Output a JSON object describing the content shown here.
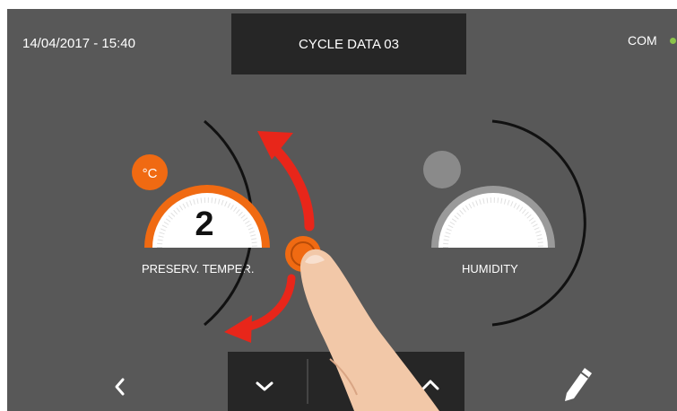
{
  "status": {
    "datetime": "14/04/2017 - 15:40",
    "com_label": "COM",
    "com_color": "#8bc34a"
  },
  "header": {
    "title": "CYCLE DATA 03"
  },
  "dials": [
    {
      "id": "preserv-temper",
      "label": "PRESERV. TEMPER.",
      "value": "2",
      "unit": "°C",
      "active": true,
      "accent": "#f06a12"
    },
    {
      "id": "humidity",
      "label": "HUMIDITY",
      "value": "",
      "active": false,
      "accent": "#8a8a8a"
    }
  ],
  "bottom_bar": {
    "back_icon": "chevron-left-icon",
    "down_icon": "chevron-down-icon",
    "up_icon": "chevron-up-icon",
    "edit_icon": "pencil-icon"
  },
  "colors": {
    "background": "#585858",
    "panel": "#262626",
    "accent": "#f06a12",
    "gesture_arrow": "#e8261a"
  }
}
